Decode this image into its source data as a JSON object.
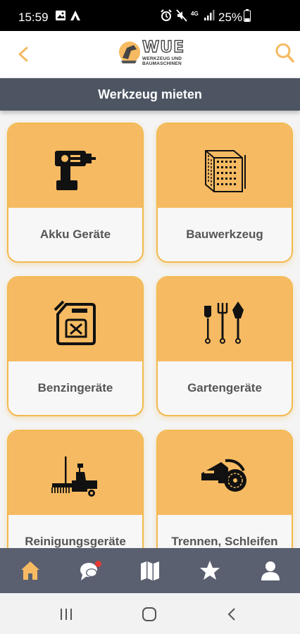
{
  "status_bar": {
    "time": "15:59",
    "network_label": "4G",
    "battery": "25%"
  },
  "header": {
    "logo_name": "WUE",
    "logo_sub1": "WERKZEUG UND",
    "logo_sub2": "BAUMASCHINEN",
    "back_icon": "chevron-left-icon",
    "search_icon": "search-icon"
  },
  "title": "Werkzeug mieten",
  "colors": {
    "accent": "#f6ba62",
    "card_border": "#f2b94e",
    "titlebar": "#4d5563",
    "bottomnav": "#5b6070",
    "notification": "#e53935"
  },
  "categories": [
    {
      "label": "Akku Geräte",
      "icon": "cordless-drill-icon"
    },
    {
      "label": "Bauwerkzeug",
      "icon": "brick-wall-icon"
    },
    {
      "label": "Benzingeräte",
      "icon": "fuel-canister-icon"
    },
    {
      "label": "Gartengeräte",
      "icon": "garden-tools-icon"
    },
    {
      "label": "Reinigungsgeräte",
      "icon": "cleaning-machine-icon"
    },
    {
      "label": "Trennen, Schleifen",
      "icon": "cut-off-saw-icon"
    }
  ],
  "bottom_nav": [
    {
      "name": "home",
      "icon": "home-icon",
      "active": true
    },
    {
      "name": "chat",
      "icon": "chat-icon",
      "badge": true
    },
    {
      "name": "map",
      "icon": "map-icon"
    },
    {
      "name": "favorites",
      "icon": "star-icon"
    },
    {
      "name": "profile",
      "icon": "user-icon"
    }
  ]
}
